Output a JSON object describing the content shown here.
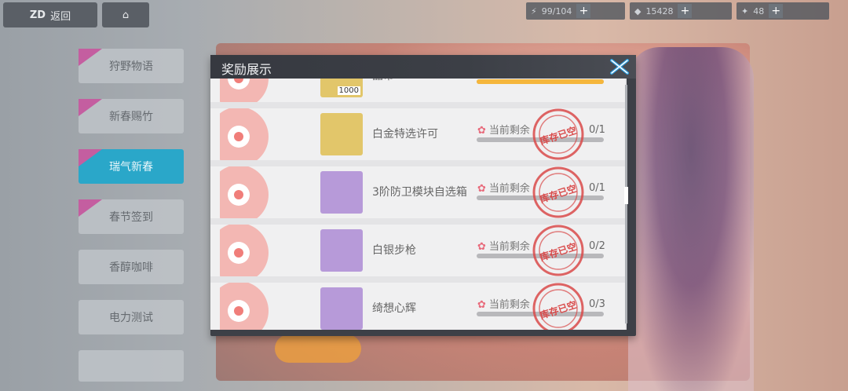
{
  "top_left": {
    "back_label": "返回"
  },
  "resources": [
    {
      "name": "stamina",
      "value": "99/104",
      "icon": "stamina-icon"
    },
    {
      "name": "crystals",
      "value": "15428",
      "icon": "crystal-icon"
    },
    {
      "name": "tokens",
      "value": "48",
      "icon": "token-icon"
    }
  ],
  "sidebar": {
    "items": [
      {
        "label": "狩野物语",
        "active": false
      },
      {
        "label": "新春赐竹",
        "active": false
      },
      {
        "label": "瑞气新春",
        "active": true
      },
      {
        "label": "春节签到",
        "active": false
      },
      {
        "label": "香醇咖啡",
        "active": false
      },
      {
        "label": "电力测试",
        "active": false
      }
    ]
  },
  "dialog": {
    "title": "奖励展示",
    "close_label": "close",
    "remain_label": "当前剩余",
    "stamp_text": "库存已空",
    "rows": [
      {
        "name": "晶币",
        "count": "",
        "badge": "1000",
        "progress": 1.0,
        "icon_bg": "gold",
        "partial": true
      },
      {
        "name": "白金特选许可",
        "count": "0/1",
        "progress": 0,
        "icon_bg": "gold"
      },
      {
        "name": "3阶防卫模块自选箱",
        "count": "0/1",
        "progress": 0,
        "icon_bg": "purple"
      },
      {
        "name": "白银步枪",
        "count": "0/2",
        "progress": 0,
        "icon_bg": "purple"
      },
      {
        "name": "绮想心辉",
        "count": "0/3",
        "progress": 0,
        "icon_bg": "purple"
      }
    ]
  },
  "colors": {
    "accent": "#2aa7c9",
    "stamp": "#d94a4a",
    "progress": "#f5b63c"
  }
}
